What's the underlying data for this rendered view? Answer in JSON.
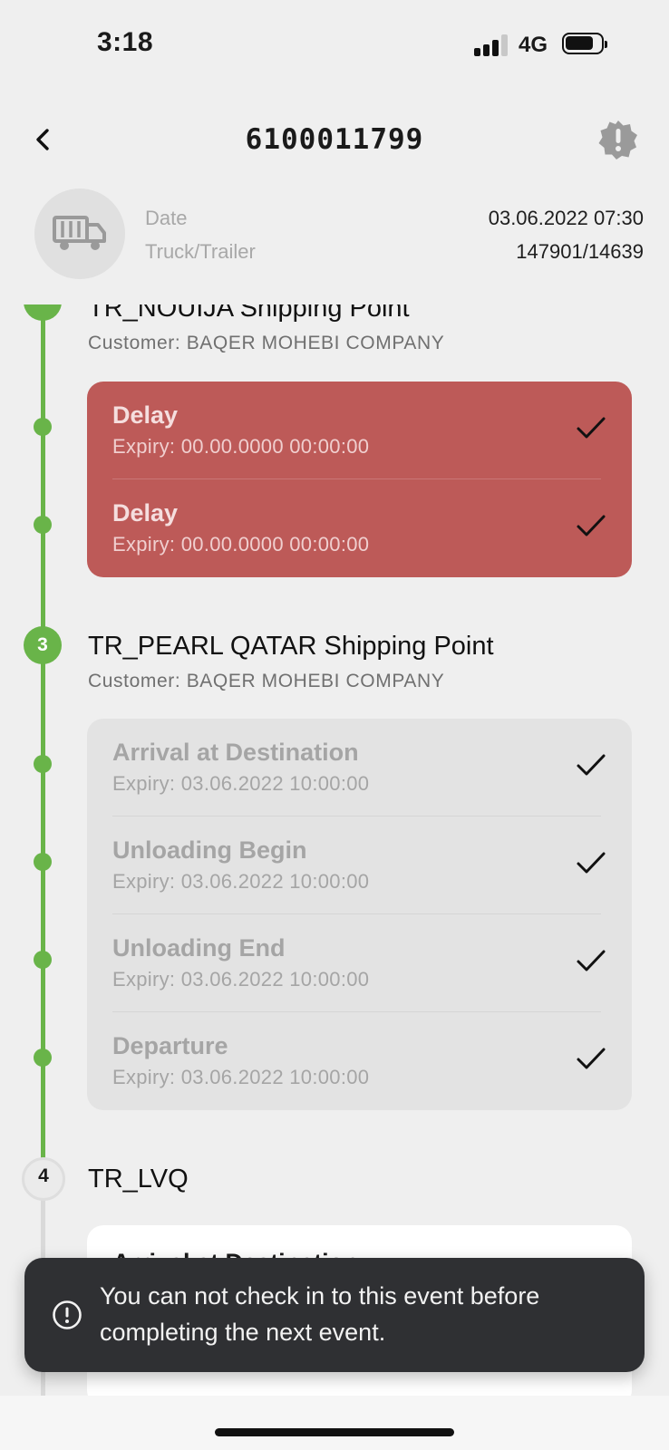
{
  "status": {
    "time": "3:18",
    "network": "4G"
  },
  "header": {
    "title": "6100011799",
    "back_icon": "chevron-left-icon",
    "alert_icon": "alert-badge-icon"
  },
  "info": {
    "date_label": "Date",
    "date_value": "03.06.2022 07:30",
    "truck_label": "Truck/Trailer",
    "truck_value": "147901/14639"
  },
  "stops": [
    {
      "title": "TR_NOUIJA Shipping Point",
      "customer": "Customer: BAQER MOHEBI COMPANY",
      "events": [
        {
          "name": "Delay",
          "expiry": "Expiry: 00.00.0000 00:00:00"
        },
        {
          "name": "Delay",
          "expiry": "Expiry: 00.00.0000 00:00:00"
        }
      ]
    },
    {
      "number": "3",
      "title": "TR_PEARL QATAR Shipping Point",
      "customer": "Customer: BAQER MOHEBI COMPANY",
      "events": [
        {
          "name": "Arrival at Destination",
          "expiry": "Expiry: 03.06.2022 10:00:00"
        },
        {
          "name": "Unloading Begin",
          "expiry": "Expiry: 03.06.2022 10:00:00"
        },
        {
          "name": "Unloading End",
          "expiry": "Expiry: 03.06.2022 10:00:00"
        },
        {
          "name": "Departure",
          "expiry": "Expiry: 03.06.2022 10:00:00"
        }
      ]
    },
    {
      "number": "4",
      "title": "TR_LVQ",
      "events": [
        {
          "name": "Arrival at Destination"
        }
      ]
    }
  ],
  "toast": {
    "icon": "exclamation-circle-icon",
    "message": "You can not check in to this event before completing the next event."
  },
  "colors": {
    "accent_green": "#69b449",
    "delay_red": "#bd5a58",
    "toast_bg": "#2f3033"
  }
}
